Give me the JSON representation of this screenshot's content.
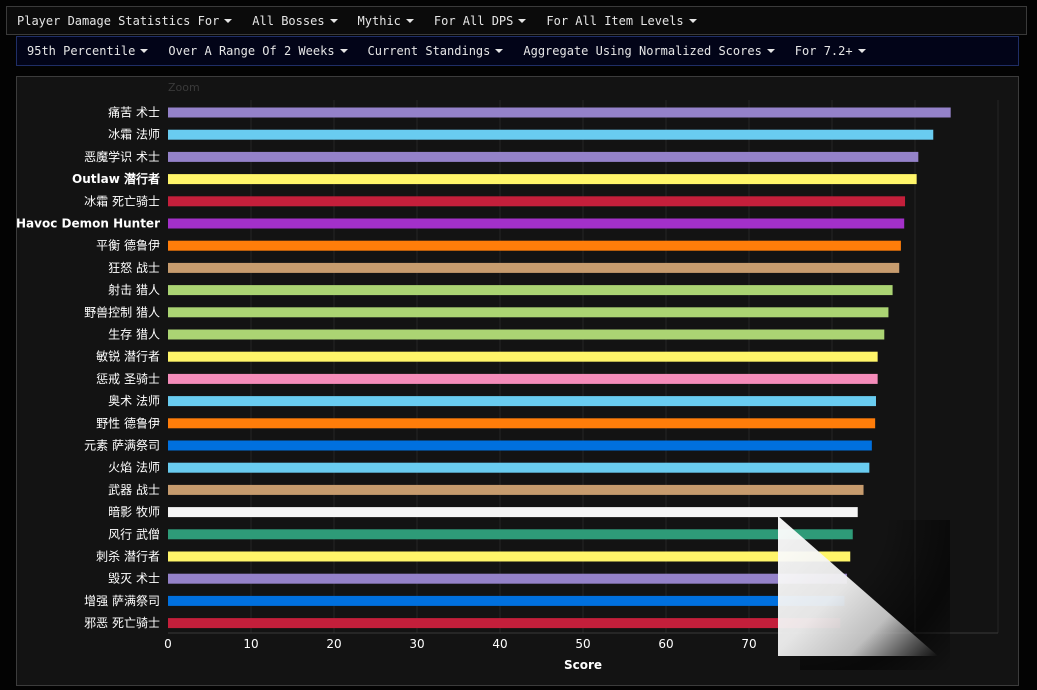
{
  "filters_row1": [
    {
      "label": "Player Damage Statistics For"
    },
    {
      "label": "All Bosses"
    },
    {
      "label": "Mythic"
    },
    {
      "label": "For All DPS"
    },
    {
      "label": "For All Item Levels"
    }
  ],
  "filters_row2": [
    {
      "label": "95th Percentile"
    },
    {
      "label": "Over A Range Of 2 Weeks"
    },
    {
      "label": "Current Standings"
    },
    {
      "label": "Aggregate Using Normalized Scores"
    },
    {
      "label": "For 7.2+"
    }
  ],
  "zoom_label": "Zoom",
  "chart_data": {
    "type": "bar",
    "orientation": "horizontal",
    "xlabel": "Score",
    "xlim": [
      0,
      100
    ],
    "x_ticks": [
      0,
      10,
      20,
      30,
      40,
      50,
      60,
      70
    ],
    "grid": true,
    "bars": [
      {
        "label": "痛苦 术士",
        "value": 94.3,
        "color": "#9482c9",
        "bold": false
      },
      {
        "label": "冰霜 法师",
        "value": 92.2,
        "color": "#69ccf0",
        "bold": false
      },
      {
        "label": "恶魔学识 术士",
        "value": 90.4,
        "color": "#9482c9",
        "bold": false
      },
      {
        "label": "Outlaw 潜行者",
        "value": 90.2,
        "color": "#fff569",
        "bold": true
      },
      {
        "label": "冰霜 死亡骑士",
        "value": 88.8,
        "color": "#c41f3b",
        "bold": false
      },
      {
        "label": "Havoc Demon Hunter",
        "value": 88.7,
        "color": "#a330c9",
        "bold": true
      },
      {
        "label": "平衡 德鲁伊",
        "value": 88.3,
        "color": "#ff7d0a",
        "bold": false
      },
      {
        "label": "狂怒 战士",
        "value": 88.1,
        "color": "#c79c6e",
        "bold": false
      },
      {
        "label": "射击 猎人",
        "value": 87.3,
        "color": "#abd473",
        "bold": false
      },
      {
        "label": "野兽控制 猎人",
        "value": 86.8,
        "color": "#abd473",
        "bold": false
      },
      {
        "label": "生存 猎人",
        "value": 86.3,
        "color": "#abd473",
        "bold": false
      },
      {
        "label": "敏锐 潜行者",
        "value": 85.5,
        "color": "#fff569",
        "bold": false
      },
      {
        "label": "惩戒 圣骑士",
        "value": 85.5,
        "color": "#f58cba",
        "bold": false
      },
      {
        "label": "奥术 法师",
        "value": 85.3,
        "color": "#69ccf0",
        "bold": false
      },
      {
        "label": "野性 德鲁伊",
        "value": 85.2,
        "color": "#ff7d0a",
        "bold": false
      },
      {
        "label": "元素 萨满祭司",
        "value": 84.8,
        "color": "#0070de",
        "bold": false
      },
      {
        "label": "火焰 法师",
        "value": 84.5,
        "color": "#69ccf0",
        "bold": false
      },
      {
        "label": "武器 战士",
        "value": 83.8,
        "color": "#c79c6e",
        "bold": false
      },
      {
        "label": "暗影 牧师",
        "value": 83.1,
        "color": "#f5f5f5",
        "bold": false
      },
      {
        "label": "风行 武僧",
        "value": 82.5,
        "color": "#2e9b78",
        "bold": false
      },
      {
        "label": "刺杀 潜行者",
        "value": 82.2,
        "color": "#fff569",
        "bold": false
      },
      {
        "label": "毁灭 术士",
        "value": 81.8,
        "color": "#9482c9",
        "bold": false
      },
      {
        "label": "增强 萨满祭司",
        "value": 81.5,
        "color": "#0070de",
        "bold": false
      },
      {
        "label": "邪恶 死亡骑士",
        "value": 81.0,
        "color": "#c41f3b",
        "bold": false
      }
    ]
  }
}
